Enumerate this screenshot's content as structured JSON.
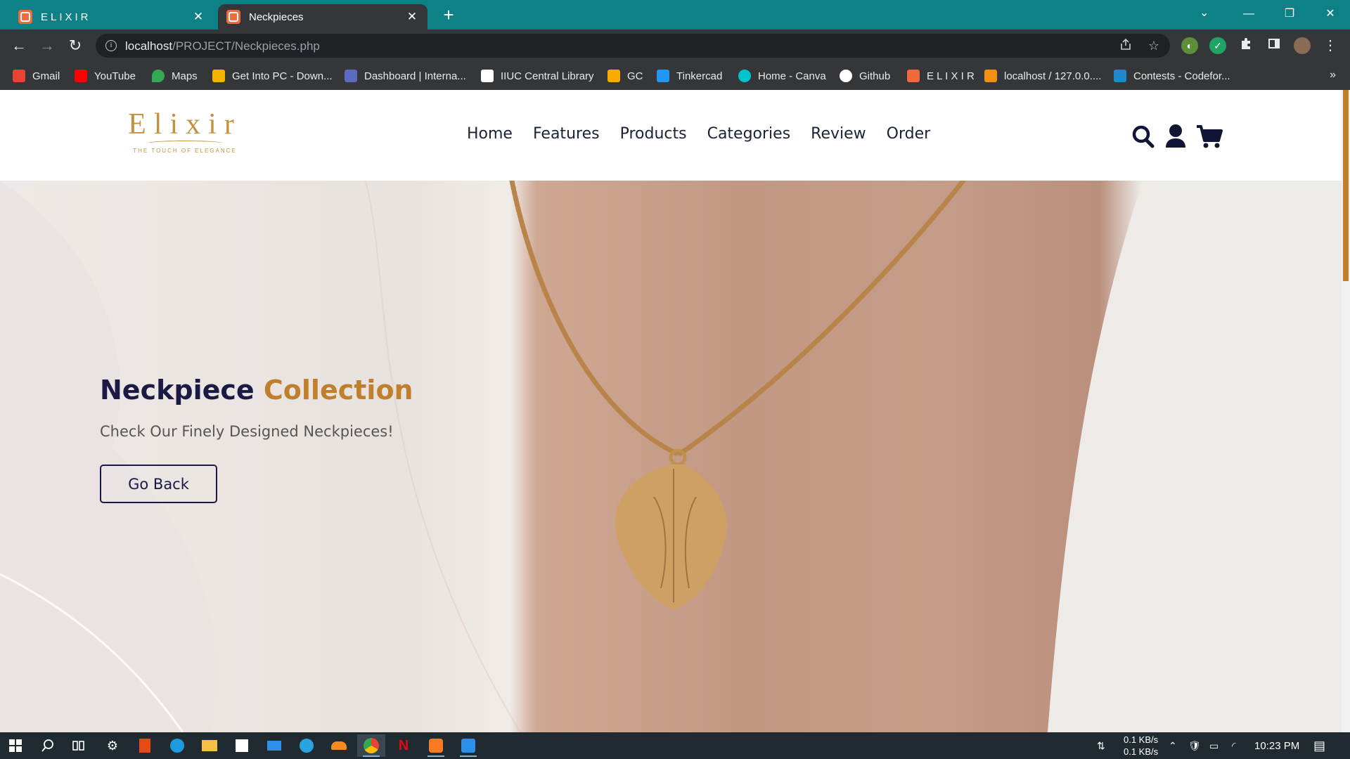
{
  "browser": {
    "tabs": [
      {
        "title": "ELIXIR",
        "close": "✕",
        "active": false
      },
      {
        "title": "Neckpieces",
        "close": "✕",
        "active": true
      }
    ],
    "new_tab": "+",
    "tab_search": "⌄",
    "window_controls": {
      "minimize": "—",
      "restore": "❐",
      "close": "✕"
    },
    "nav": {
      "back": "←",
      "forward": "→",
      "reload": "↻"
    },
    "url": {
      "host": "localhost",
      "path": "/PROJECT/Neckpieces.php"
    },
    "bookmarks": [
      {
        "label": "Gmail",
        "icon": "gmail-icon",
        "color": "#ea4335"
      },
      {
        "label": "YouTube",
        "icon": "youtube-icon",
        "color": "#ff0000"
      },
      {
        "label": "Maps",
        "icon": "maps-icon",
        "color": "#34a853"
      },
      {
        "label": "Get Into PC - Down...",
        "icon": "getintopc-icon",
        "color": "#f4b400"
      },
      {
        "label": "Dashboard | Interna...",
        "icon": "dashboard-icon",
        "color": "#5c6bc0"
      },
      {
        "label": "IIUC Central Library",
        "icon": "library-icon",
        "color": "#ffffff"
      },
      {
        "label": "GC",
        "icon": "classroom-icon",
        "color": "#f9ab00"
      },
      {
        "label": "Tinkercad",
        "icon": "tinkercad-icon",
        "color": "#2196f3"
      },
      {
        "label": "Home - Canva",
        "icon": "canva-icon",
        "color": "#00c4cc"
      },
      {
        "label": "Github",
        "icon": "github-icon",
        "color": "#ffffff"
      },
      {
        "label": "E L I X I R",
        "icon": "elixir-favicon-icon",
        "color": "#ee6a3a"
      },
      {
        "label": "localhost / 127.0.0....",
        "icon": "phpmyadmin-icon",
        "color": "#f29111"
      },
      {
        "label": "Contests - Codefor...",
        "icon": "codeforces-icon",
        "color": "#1f8acb"
      }
    ],
    "bookmarks_more": "»"
  },
  "site": {
    "logo": {
      "word": "Elixir",
      "tagline": "THE TOUCH OF ELEGANCE"
    },
    "nav": [
      "Home",
      "Features",
      "Products",
      "Categories",
      "Review",
      "Order"
    ],
    "header_icons": [
      "search-icon",
      "user-icon",
      "cart-icon"
    ],
    "hero": {
      "title_main": "Neckpiece",
      "title_accent": "Collection",
      "subtitle": "Check Our Finely Designed Neckpieces!",
      "button": "Go Back"
    },
    "colors": {
      "navy": "#1a1a45",
      "accent": "#c07f2c"
    }
  },
  "taskbar": {
    "net_down": "0.1 KB/s",
    "net_up": "0.1 KB/s",
    "time": "10:23 PM"
  }
}
